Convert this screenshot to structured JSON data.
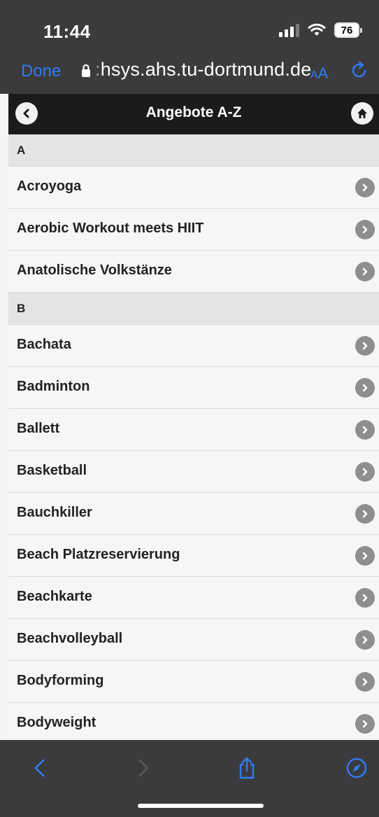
{
  "status_bar": {
    "time": "11:44",
    "battery": "76"
  },
  "browser": {
    "done_label": "Done",
    "url_prefix": ":",
    "url_domain": "hsys.ahs.tu-dortmund.de",
    "text_size_label_small": "A",
    "text_size_label_large": "A"
  },
  "header": {
    "title": "Angebote A-Z"
  },
  "sections": [
    {
      "letter": "A",
      "items": [
        "Acroyoga",
        "Aerobic Workout meets HIIT",
        "Anatolische Volkstänze"
      ]
    },
    {
      "letter": "B",
      "items": [
        "Bachata",
        "Badminton",
        "Ballett",
        "Basketball",
        "Bauchkiller",
        "Beach Platzreservierung",
        "Beachkarte",
        "Beachvolleyball",
        "Bodyforming",
        "Bodyweight"
      ]
    }
  ],
  "colors": {
    "accent": "#2f7cf6",
    "header_bg": "#1b1b1b",
    "browser_chrome": "#3b3b3d"
  }
}
